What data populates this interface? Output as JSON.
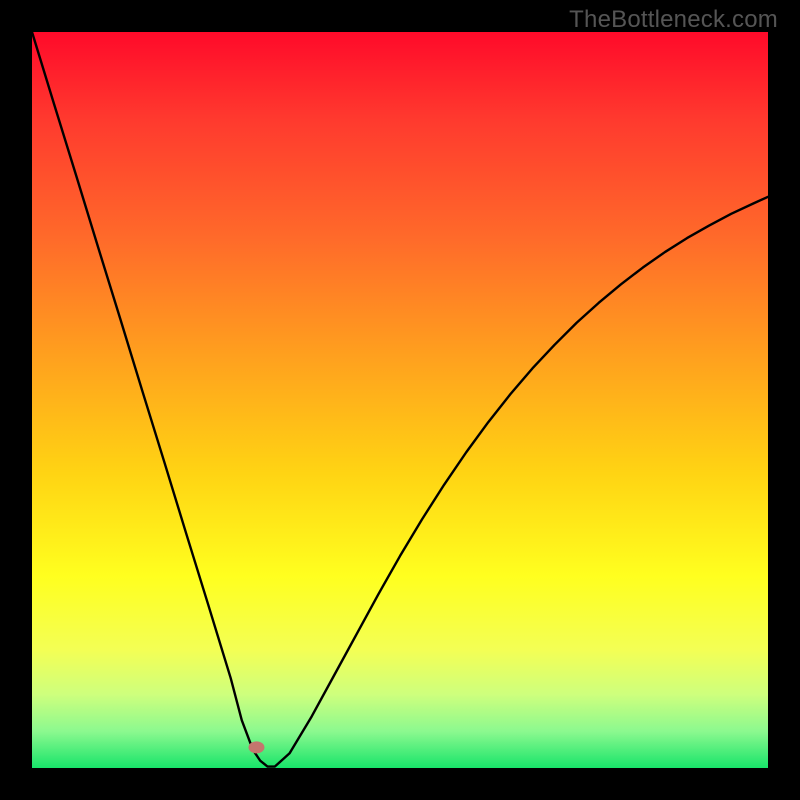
{
  "watermark": "TheBottleneck.com",
  "chart_data": {
    "type": "line",
    "title": "",
    "xlabel": "",
    "ylabel": "",
    "xlim": [
      0,
      100
    ],
    "ylim": [
      0,
      100
    ],
    "grid": false,
    "legend": false,
    "series": [
      {
        "name": "bottleneck-curve",
        "x": [
          0,
          3,
          6,
          9,
          12,
          15,
          18,
          21,
          24,
          27,
          28.5,
          30,
          31,
          32,
          33,
          35,
          38,
          41,
          44,
          47,
          50,
          53,
          56,
          59,
          62,
          65,
          68,
          71,
          74,
          77,
          80,
          83,
          86,
          89,
          92,
          95,
          98,
          100
        ],
        "y": [
          100,
          90.2,
          80.5,
          70.7,
          61.0,
          51.2,
          41.5,
          31.7,
          22.0,
          12.2,
          6.5,
          2.5,
          1.0,
          0.2,
          0.2,
          2.0,
          7.0,
          12.5,
          18.0,
          23.5,
          28.8,
          33.8,
          38.5,
          42.9,
          47.0,
          50.8,
          54.3,
          57.5,
          60.5,
          63.2,
          65.7,
          68.0,
          70.1,
          72.0,
          73.7,
          75.3,
          76.7,
          77.6
        ]
      }
    ],
    "background_gradient": {
      "stops": [
        {
          "offset": 0.0,
          "color": "#ff0a2a"
        },
        {
          "offset": 0.12,
          "color": "#ff3a2e"
        },
        {
          "offset": 0.28,
          "color": "#ff6a2a"
        },
        {
          "offset": 0.44,
          "color": "#ffa01e"
        },
        {
          "offset": 0.6,
          "color": "#ffd413"
        },
        {
          "offset": 0.74,
          "color": "#ffff1f"
        },
        {
          "offset": 0.84,
          "color": "#f3ff55"
        },
        {
          "offset": 0.9,
          "color": "#ceff7d"
        },
        {
          "offset": 0.95,
          "color": "#8cf98f"
        },
        {
          "offset": 1.0,
          "color": "#18e46a"
        }
      ]
    },
    "marker": {
      "x_frac": 0.305,
      "y_frac": 0.972,
      "rx": 8,
      "ry": 6,
      "fill": "#c4766e"
    }
  }
}
